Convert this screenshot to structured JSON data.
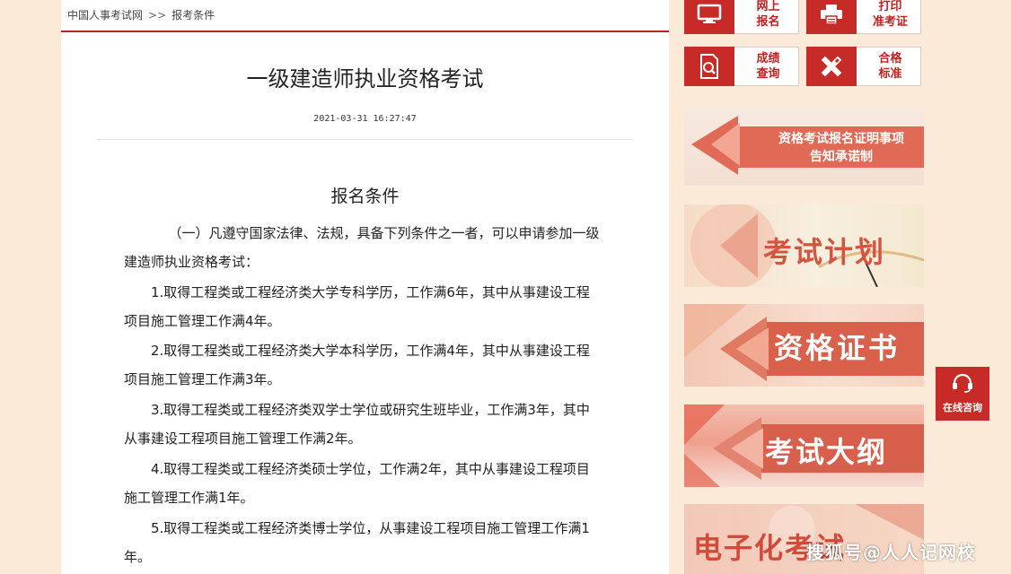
{
  "breadcrumb": {
    "home": "中国人事考试网",
    "separator": ">>",
    "current": "报考条件"
  },
  "article": {
    "title": "一级建造师执业资格考试",
    "date": "2021-03-31 16:27:47",
    "subtitle": "报名条件",
    "paragraphs": [
      "（一）凡遵守国家法律、法规，具备下列条件之一者，可以申请参加一级建造师执业资格考试：",
      "1.取得工程类或工程经济类大学专科学历，工作满6年，其中从事建设工程项目施工管理工作满4年。",
      "2.取得工程类或工程经济类大学本科学历，工作满4年，其中从事建设工程项目施工管理工作满3年。",
      "3.取得工程类或工程经济类双学士学位或研究生班毕业，工作满3年，其中从事建设工程项目施工管理工作满2年。",
      "4.取得工程类或工程经济类硕士学位，工作满2年，其中从事建设工程项目施工管理工作满1年。",
      "5.取得工程类或工程经济类博士学位，从事建设工程项目施工管理工作满1年。"
    ]
  },
  "quick_links": [
    {
      "label_line1": "网上",
      "label_line2": "报名",
      "icon": "monitor-icon"
    },
    {
      "label_line1": "打印",
      "label_line2": "准考证",
      "icon": "printer-icon"
    },
    {
      "label_line1": "成绩",
      "label_line2": "查询",
      "icon": "magnifier-document-icon"
    },
    {
      "label_line1": "合格",
      "label_line2": "标准",
      "icon": "pencil-ruler-icon"
    }
  ],
  "banners": {
    "notice_line1": "资格考试报名证明事项",
    "notice_line2": "告知承诺制",
    "plan": "考试计划",
    "certificate": "资格证书",
    "syllabus": "考试大纲",
    "electronic": "电子化考试"
  },
  "online_consult": {
    "label": "在线咨询",
    "icon": "headset-icon"
  },
  "watermark": "搜狐号@人人记网校",
  "colors": {
    "brand_red": "#c72b27",
    "banner_coral": "#e06a55",
    "page_bg": "#fbead7"
  }
}
